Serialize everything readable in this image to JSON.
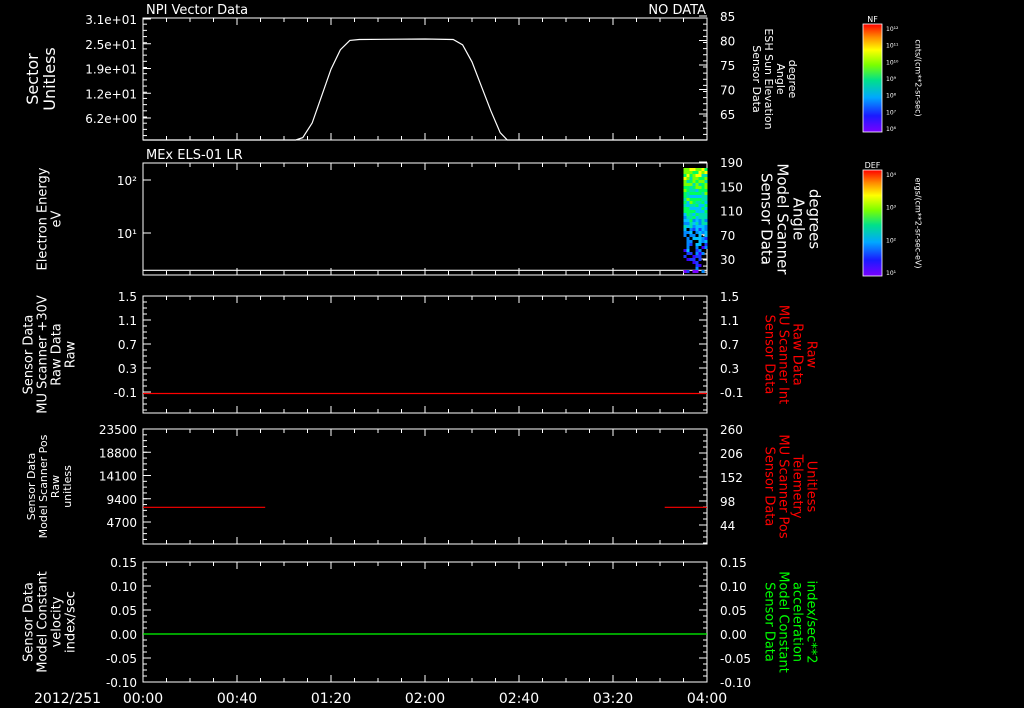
{
  "chart_data": {
    "type": "line",
    "x_axis": {
      "date_label": "2012/251",
      "ticks": [
        "00:00",
        "00:40",
        "01:20",
        "02:00",
        "02:40",
        "03:20",
        "04:00"
      ],
      "range_minutes": [
        0,
        240
      ],
      "tick_minutes": [
        0,
        40,
        80,
        120,
        160,
        200,
        240
      ]
    },
    "panels": [
      {
        "id": "npi",
        "title_left": "NPI Vector Data",
        "title_right": "NO DATA",
        "left_label": [
          "Sector",
          "Unitless"
        ],
        "left_ticks": [
          "3.1e+01",
          "2.5e+01",
          "1.9e+01",
          "1.2e+01",
          "6.2e+00"
        ],
        "right_label": [
          "Sensor Data",
          "ESH Sun Elevation",
          "Angle",
          "degree"
        ],
        "right_label_color": "#ffffff",
        "right_ticks": [
          "85",
          "80",
          "75",
          "70",
          "65"
        ],
        "right_range": [
          60,
          85
        ],
        "series": [
          {
            "axis": "right",
            "color": "#ffffff",
            "x": [
              0,
              65,
              68,
              72,
              76,
              80,
              84,
              88,
              92,
              120,
              132,
              136,
              140,
              144,
              148,
              152,
              155,
              240
            ],
            "y": [
              60,
              60,
              60.5,
              63.5,
              69,
              74.5,
              78.5,
              80.4,
              80.6,
              80.7,
              80.6,
              79.5,
              76,
              71,
              66,
              61.5,
              60,
              60
            ]
          }
        ]
      },
      {
        "id": "els",
        "title_left": "MEx ELS-01 LR",
        "left_label": [
          "Electron Energy",
          "eV"
        ],
        "left_ticks": [
          "10²",
          "10¹"
        ],
        "right_label": [
          "Sensor Data",
          "Model Scanner",
          "Angle",
          "degrees"
        ],
        "right_label_color": "#ffffff",
        "right_ticks": [
          "190",
          "150",
          "110",
          "70",
          "30"
        ],
        "right_range": [
          0,
          190
        ],
        "series": [
          {
            "axis": "right",
            "color": "#ffffff",
            "x": [
              0,
              240
            ],
            "y": [
              8,
              8
            ]
          }
        ],
        "spectrogram_minutes": [
          230,
          239
        ]
      },
      {
        "id": "mu_int",
        "left_label": [
          "Sensor Data",
          "MU Scanner +30V",
          "Raw Data",
          "Raw"
        ],
        "left_ticks": [
          "1.5",
          "1.1",
          "0.7",
          "0.3",
          "-0.1"
        ],
        "left_range": [
          -0.3,
          1.5
        ],
        "right_label": [
          "Sensor Data",
          "MU Scanner Int",
          "Raw Data",
          "Raw"
        ],
        "right_label_color": "#ff0000",
        "right_ticks": [
          "1.5",
          "1.1",
          "0.7",
          "0.3",
          "-0.1"
        ],
        "right_range": [
          -0.3,
          1.5
        ],
        "series": [
          {
            "axis": "right",
            "color": "#ff0000",
            "x": [
              0,
              240
            ],
            "y": [
              0,
              0
            ]
          }
        ]
      },
      {
        "id": "mu_pos",
        "left_label": [
          "Sensor Data",
          "Model Scanner Pos",
          "Raw",
          "unitless"
        ],
        "left_ticks": [
          "23500",
          "18800",
          "14100",
          "9400",
          "4700"
        ],
        "left_range": [
          0,
          23500
        ],
        "right_label": [
          "Sensor Data",
          "MU Scanner Pos",
          "Telemetry",
          "Unitless"
        ],
        "right_label_color": "#ff0000",
        "right_ticks": [
          "260",
          "206",
          "152",
          "98",
          "44"
        ],
        "right_range": [
          0,
          260
        ],
        "series": [
          {
            "axis": "right",
            "color": "#ff0000",
            "x": [
              0,
              52
            ],
            "y": [
              83,
              83
            ]
          },
          {
            "axis": "right",
            "color": "#ff0000",
            "x": [
              222,
              240
            ],
            "y": [
              83,
              83
            ]
          }
        ]
      },
      {
        "id": "model_const",
        "left_label": [
          "Sensor Data",
          "Model Constant",
          "velocity",
          "index/sec"
        ],
        "left_ticks": [
          "0.15",
          "0.10",
          "0.05",
          "0.00",
          "-0.05",
          "-0.10"
        ],
        "left_range": [
          -0.1,
          0.15
        ],
        "right_label": [
          "Sensor Data",
          "Model Constant",
          "acceleration",
          "index/sec**2"
        ],
        "right_label_color": "#00ff00",
        "right_ticks": [
          "0.15",
          "0.10",
          "0.05",
          "0.00",
          "-0.05",
          "-0.10"
        ],
        "right_range": [
          -0.1,
          0.15
        ],
        "series": [
          {
            "axis": "right",
            "color": "#00ff00",
            "x": [
              0,
              240
            ],
            "y": [
              0,
              0
            ]
          }
        ]
      }
    ],
    "colorbars": [
      {
        "id": "nf",
        "title": "NF",
        "units": "cnts/(cm**2-sr-sec)",
        "ticks": [
          "10¹²",
          "10¹¹",
          "10¹⁰",
          "10⁹",
          "10⁸",
          "10⁷",
          "10⁶"
        ]
      },
      {
        "id": "def",
        "title": "DEF",
        "units": "ergs/(cm**2-sr-sec-eV)",
        "ticks": [
          "10⁴",
          "10³",
          "10²",
          "10¹"
        ]
      }
    ]
  }
}
